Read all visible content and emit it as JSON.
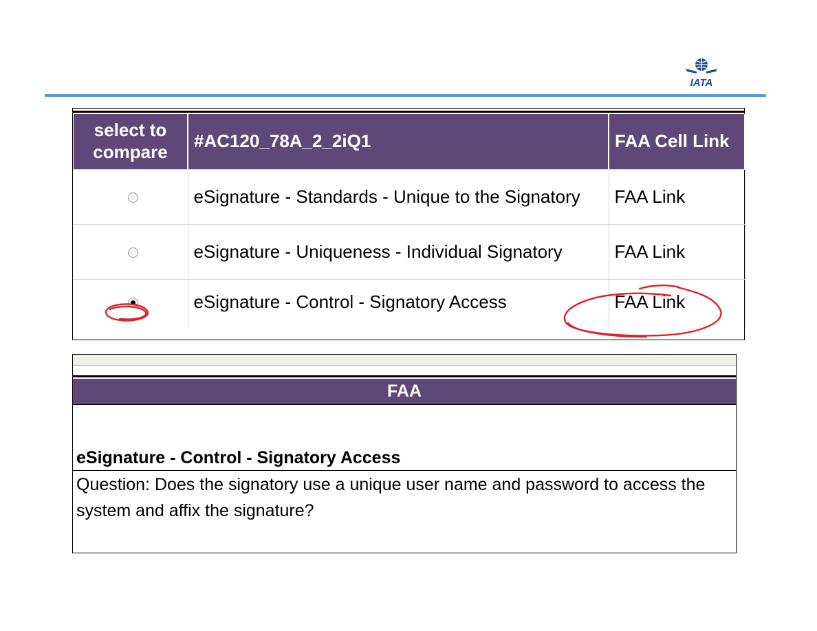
{
  "brand": {
    "logo_text": "IATA",
    "accent_color": "#5b9bd5",
    "header_color": "#5f4877",
    "annotation_color": "#e0202a"
  },
  "compare_table": {
    "columns": {
      "select": "select to compare",
      "id": "#AC120_78A_2_2iQ1",
      "link": "FAA Cell Link"
    },
    "rows": [
      {
        "selected": false,
        "title": "eSignature - Standards - Unique to the Signatory",
        "link": "FAA Link"
      },
      {
        "selected": false,
        "title": "eSignature - Uniqueness - Individual Signatory",
        "link": "FAA Link"
      },
      {
        "selected": true,
        "title": "eSignature - Control - Signatory Access",
        "link": "FAA Link"
      }
    ]
  },
  "detail": {
    "header": "FAA",
    "title": "eSignature - Control - Signatory Access",
    "question": "Question: Does the signatory use a unique user name and password to access the system and affix the signature?"
  },
  "annotations": {
    "circle_selected_radio": "red-ellipse",
    "circle_selected_link": "red-ellipse"
  }
}
